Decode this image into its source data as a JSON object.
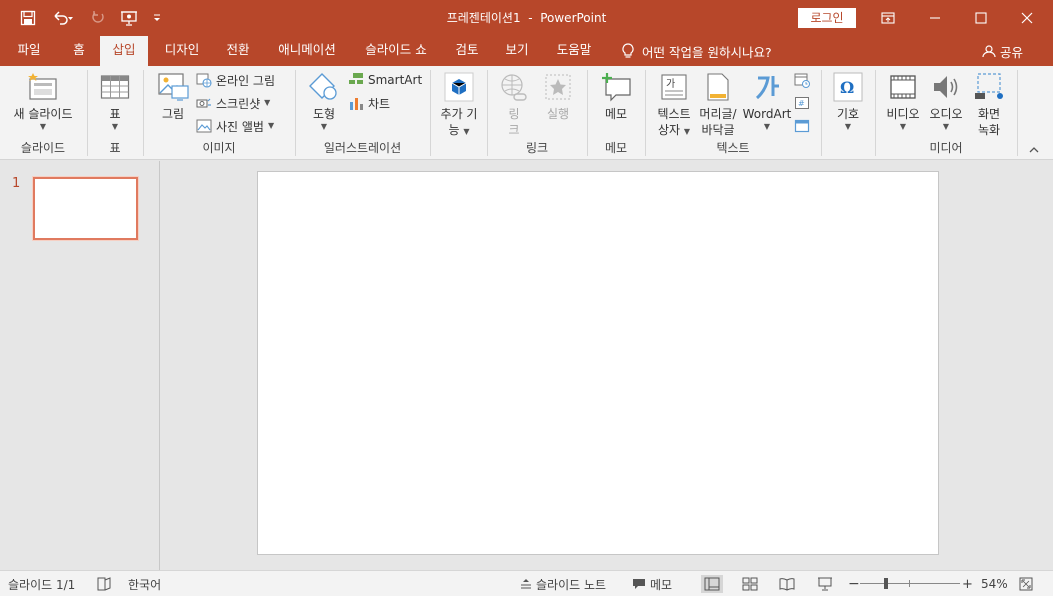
{
  "colors": {
    "accent": "#b7472a",
    "ribbon_bg": "#f3f3f3",
    "workspace_bg": "#e6e6e6",
    "slide_selection": "#e07a5f"
  },
  "title": {
    "document": "프레젠테이션1",
    "separator": "-",
    "app": "PowerPoint"
  },
  "signin_label": "로그인",
  "tabs": [
    "파일",
    "홈",
    "삽입",
    "디자인",
    "전환",
    "애니메이션",
    "슬라이드 쇼",
    "검토",
    "보기",
    "도움말"
  ],
  "active_tab": "삽입",
  "tell_me": "어떤 작업을 원하시나요?",
  "share_label": "공유",
  "ribbon": {
    "new_slide": {
      "label": "새 슬라이드",
      "group": "슬라이드"
    },
    "table": {
      "label": "표",
      "group": "표"
    },
    "images": {
      "picture": "그림",
      "online_picture": "온라인 그림",
      "screenshot": "스크린샷",
      "photo_album": "사진 앨범",
      "group": "이미지"
    },
    "illustrations": {
      "shapes": "도형",
      "smartart": "SmartArt",
      "chart": "차트",
      "group": "일러스트레이션"
    },
    "addins": {
      "label_line1": "추가 기",
      "label_line2": "능"
    },
    "links": {
      "link_line1": "링",
      "link_line2": "크",
      "action": "실행",
      "group": "링크"
    },
    "comments": {
      "label": "메모",
      "group": "메모"
    },
    "text": {
      "textbox_line1": "텍스트",
      "textbox_line2": "상자",
      "header_line1": "머리글/",
      "header_line2": "바닥글",
      "wordart": "WordArt",
      "group": "텍스트"
    },
    "symbols": {
      "label": "기호"
    },
    "media": {
      "video": "비디오",
      "audio": "오디오",
      "screen_line1": "화면",
      "screen_line2": "녹화",
      "group": "미디어"
    }
  },
  "slides": {
    "number": "1"
  },
  "status": {
    "slide_counter": "슬라이드 1/1",
    "language": "한국어",
    "notes": "슬라이드 노트",
    "comments": "메모",
    "zoom_minus": "−",
    "zoom_plus": "+",
    "zoom": "54%"
  }
}
